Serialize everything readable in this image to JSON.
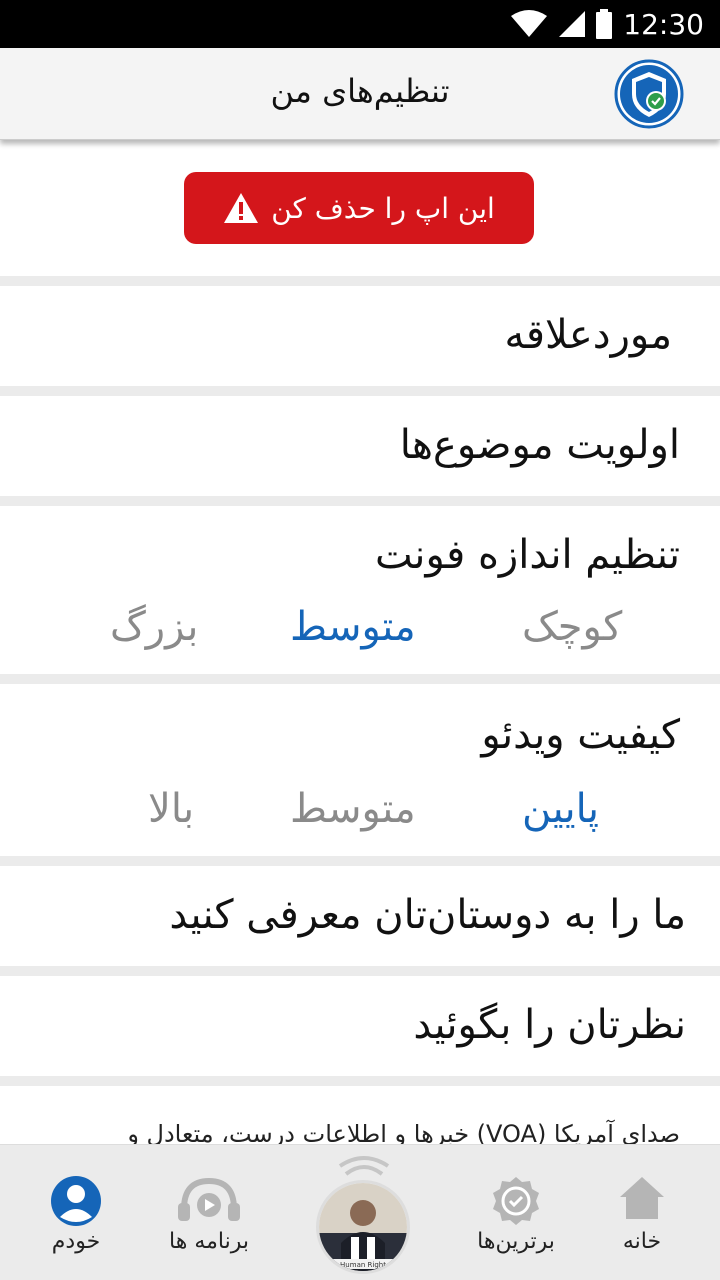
{
  "status_bar": {
    "time": "12:30"
  },
  "header": {
    "title": "تنظیم‌های من",
    "logo_icon": "shield-check-icon"
  },
  "delete_app": {
    "label": "این اپ را حذف کن",
    "icon": "warning-icon",
    "color": "#d4161b"
  },
  "settings": {
    "favorites": "موردعلاقه",
    "topic_priority": "اولویت موضوع‌ها",
    "font_size": {
      "title": "تنظیم اندازه فونت",
      "options": [
        "کوچک",
        "متوسط",
        "بزرگ"
      ],
      "selected": "متوسط"
    },
    "video_quality": {
      "title": "کیفیت ویدئو",
      "options": [
        "پایین",
        "متوسط",
        "بالا"
      ],
      "selected": "پایین"
    },
    "share": "ما را به دوستان‌تان معرفی کنید",
    "feedback": "نظرتان را بگوئید"
  },
  "about_text": "صدای آمریکا (VOA) خبرها و اطلاعات درست، متعادل و",
  "bottom_nav": {
    "home": {
      "label": "خانه",
      "icon": "home-icon"
    },
    "top": {
      "label": "برترین‌ها",
      "icon": "badge-check-icon"
    },
    "player": {
      "icon": "headphones-waves-icon",
      "thumb_caption": "Human Right"
    },
    "programs": {
      "label": "برنامه ها",
      "icon": "headphones-play-icon"
    },
    "profile": {
      "label": "خودم",
      "icon": "person-icon",
      "active_color": "#1565b8"
    }
  },
  "colors": {
    "accent": "#1565b8",
    "inactive": "#8a8a8a",
    "danger": "#d4161b"
  }
}
